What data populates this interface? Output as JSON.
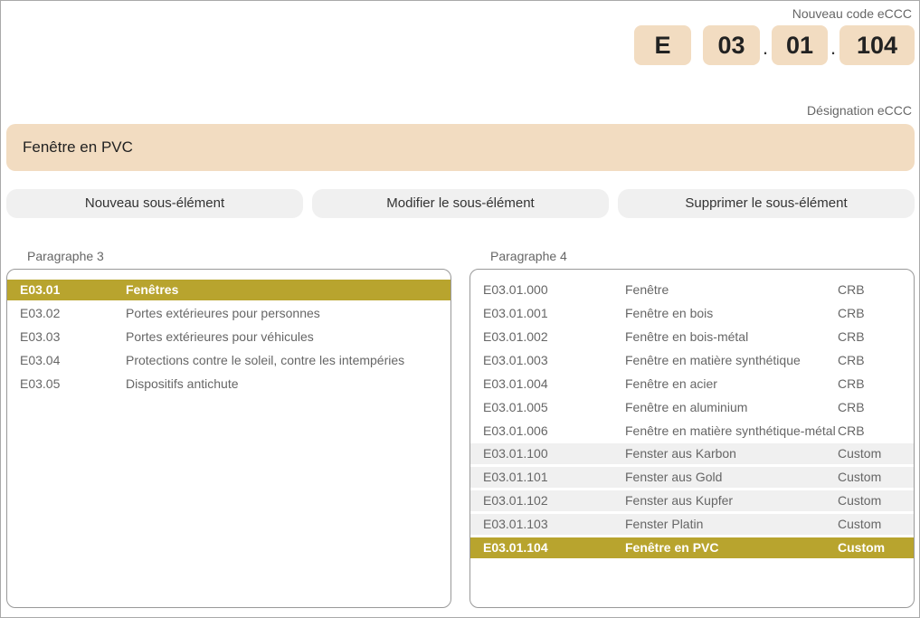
{
  "code": {
    "label": "Nouveau code eCCC",
    "segments": [
      "E",
      "03",
      "01",
      "104"
    ],
    "separator": "."
  },
  "designation": {
    "label": "Désignation eCCC",
    "value": "Fenêtre en PVC"
  },
  "buttons": {
    "new": "Nouveau sous-élément",
    "edit": "Modifier le sous-élément",
    "delete": "Supprimer le sous-élément"
  },
  "paragraph3": {
    "label": "Paragraphe 3",
    "selected_index": 0,
    "rows": [
      {
        "code": "E03.01",
        "name": "Fenêtres"
      },
      {
        "code": "E03.02",
        "name": "Portes extérieures pour personnes"
      },
      {
        "code": "E03.03",
        "name": "Portes extérieures pour véhicules"
      },
      {
        "code": "E03.04",
        "name": "Protections contre le soleil, contre les intempéries"
      },
      {
        "code": "E03.05",
        "name": "Dispositifs antichute"
      }
    ]
  },
  "paragraph4": {
    "label": "Paragraphe 4",
    "selected_index": 11,
    "rows": [
      {
        "code": "E03.01.000",
        "name": "Fenêtre",
        "source": "CRB"
      },
      {
        "code": "E03.01.001",
        "name": "Fenêtre en bois",
        "source": "CRB"
      },
      {
        "code": "E03.01.002",
        "name": "Fenêtre en bois-métal",
        "source": "CRB"
      },
      {
        "code": "E03.01.003",
        "name": "Fenêtre en matière synthétique",
        "source": "CRB"
      },
      {
        "code": "E03.01.004",
        "name": "Fenêtre en acier",
        "source": "CRB"
      },
      {
        "code": "E03.01.005",
        "name": "Fenêtre en aluminium",
        "source": "CRB"
      },
      {
        "code": "E03.01.006",
        "name": "Fenêtre en matière synthétique-métal",
        "source": "CRB"
      },
      {
        "code": "E03.01.100",
        "name": "Fenster aus Karbon",
        "source": "Custom"
      },
      {
        "code": "E03.01.101",
        "name": "Fenster aus Gold",
        "source": "Custom"
      },
      {
        "code": "E03.01.102",
        "name": "Fenster aus Kupfer",
        "source": "Custom"
      },
      {
        "code": "E03.01.103",
        "name": "Fenster Platin",
        "source": "Custom"
      },
      {
        "code": "E03.01.104",
        "name": "Fenêtre en PVC",
        "source": "Custom"
      }
    ]
  },
  "colors": {
    "accent": "#b8a42e",
    "code_box": "#f2dcc1",
    "custom_row": "#f0f0f0"
  }
}
